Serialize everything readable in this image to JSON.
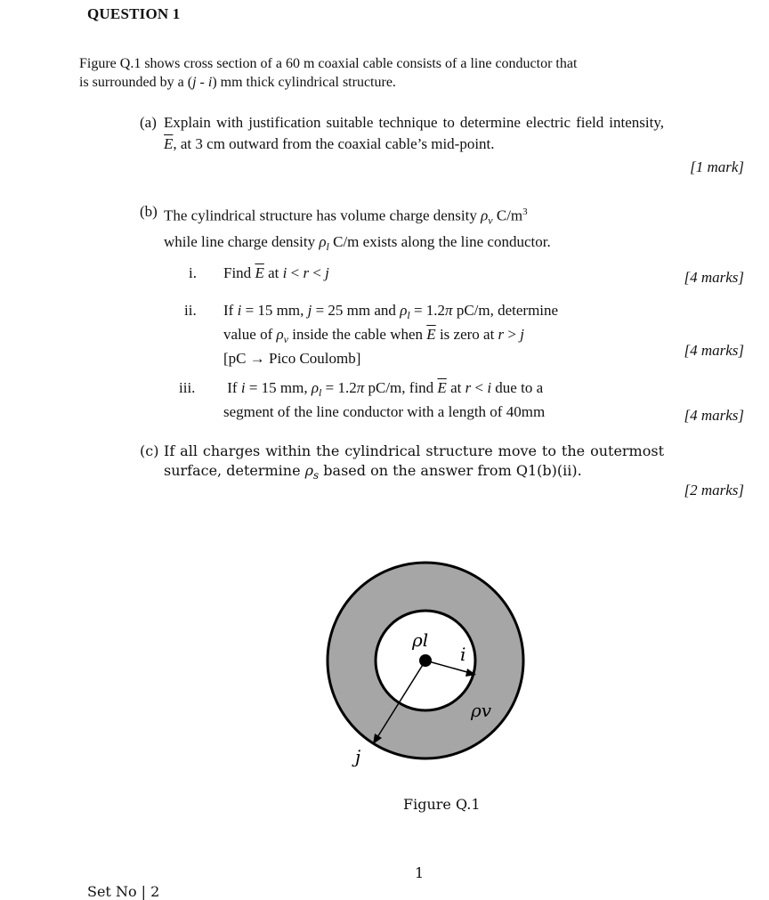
{
  "question_title": "QUESTION 1",
  "intro": {
    "line1": "Figure Q.1 shows cross section of a 60 m coaxial cable consists of a line conductor that",
    "line2": "is surrounded by a (j - i) mm thick cylindrical structure."
  },
  "parts": {
    "a": {
      "label": "(a)",
      "text": "Explain with justification suitable technique to determine electric field intensity, Ē, at 3 cm outward from the coaxial cable’s mid-point.",
      "marks": "[1 mark]"
    },
    "b": {
      "label": "(b)",
      "text_line1": "The cylindrical structure has volume charge density ρv C/m³",
      "text_line2": "while line charge density ρl C/m exists along the line conductor.",
      "sub": [
        {
          "label": "i.",
          "text": "Find Ē at i < r < j",
          "marks": "[4 marks]"
        },
        {
          "label": "ii.",
          "text_line1": "If i = 15 mm, j = 25 mm and ρl = 1.2π pC/m, determine",
          "text_line2": "value of ρv inside the cable when Ē is zero at r > j",
          "text_line3": "[pC → Pico Coulomb]",
          "marks": "[4 marks]"
        },
        {
          "label": "iii.",
          "text_line1": "If i = 15 mm, ρl = 1.2π pC/m, find Ē at r < i due to a",
          "text_line2": "segment of the line conductor with a length of 40mm",
          "marks": "[4 marks]"
        }
      ]
    },
    "c": {
      "label": "(c)",
      "text": "If all charges within the cylindrical structure move to the outermost surface, determine ρs based on the answer from Q1(b)(ii).",
      "marks": "[2 marks]"
    }
  },
  "figure": {
    "caption": "Figure Q.1",
    "labels": {
      "line_charge": "ρl",
      "inner_radius": "i",
      "outer_radius": "j",
      "volume_charge": "ρv"
    },
    "colors": {
      "shell_fill": "#a6a6a6",
      "outline": "#000000",
      "inner_fill": "#ffffff"
    }
  },
  "footer": {
    "page_number": "1",
    "set_no": "Set No | 2"
  }
}
